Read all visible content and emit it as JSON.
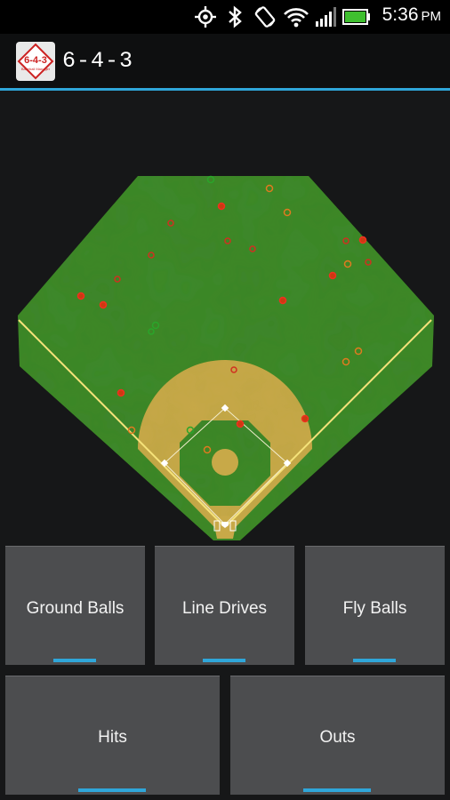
{
  "status_bar": {
    "time": "5:36",
    "ampm": "PM",
    "icons": [
      "gps-icon",
      "bluetooth-icon",
      "rotation-lock-icon",
      "wifi-icon",
      "signal-icon",
      "battery-icon"
    ],
    "battery_color": "#3fbf2f"
  },
  "app": {
    "title": "6-4-3",
    "icon_label": "6-4-3",
    "icon_sub": "Baseball Manager",
    "accent": "#2fa6d9"
  },
  "field": {
    "grass": "#3e8a2a",
    "dirt": "#c8a948",
    "dot_colors": {
      "hit": "#f03020",
      "out": "#e07a20",
      "green": "#2aa52a"
    }
  },
  "filters": {
    "ground_balls": "Ground Balls",
    "line_drives": "Line Drives",
    "fly_balls": "Fly Balls",
    "hits": "Hits",
    "outs": "Outs"
  }
}
